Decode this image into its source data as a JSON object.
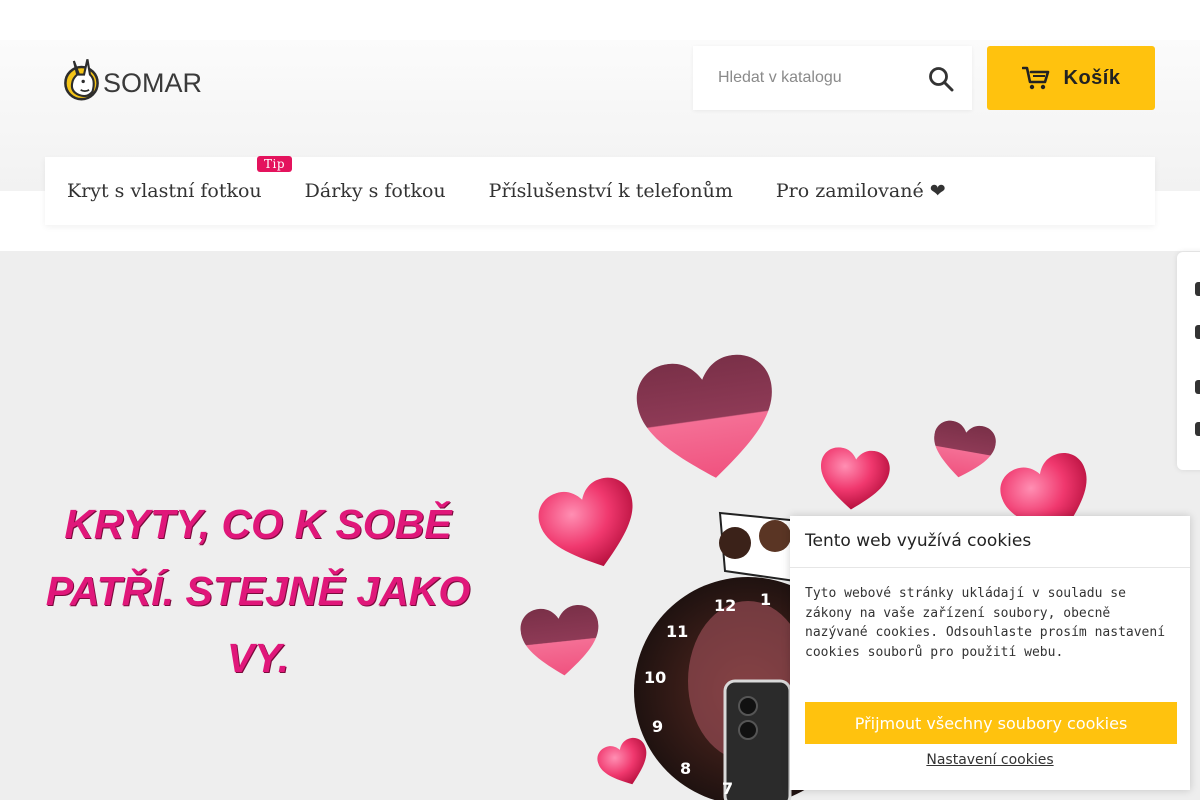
{
  "brand": {
    "logo_text": "SOMAR"
  },
  "search": {
    "placeholder": "Hledat v katalogu"
  },
  "cart": {
    "label": "Košík"
  },
  "nav": {
    "items": [
      {
        "label": "Kryt s vlastní fotkou",
        "badge": "Tip"
      },
      {
        "label": "Dárky s fotkou"
      },
      {
        "label": "Příslušenství k telefonům"
      },
      {
        "label": "Pro zamilované ❤"
      }
    ]
  },
  "hero": {
    "title_line1": "KRYTY, CO K SOBĚ",
    "title_line2": "PATŘÍ. STEJNĚ JAKO",
    "title_line3": "VY.",
    "clock_numbers": [
      "12",
      "1",
      "11",
      "10",
      "9",
      "8",
      "7"
    ]
  },
  "cookie_banner": {
    "title": "Tento web využívá cookies",
    "body": "Tyto webové stránky ukládají v souladu se zákony na vaše zařízení soubory, obecně nazývané cookies. Odsouhlaste prosím nastavení cookies souborů pro použití webu.",
    "accept_label": "Přijmout všechny soubory cookies",
    "settings_label": "Nastavení cookies"
  },
  "colors": {
    "accent_yellow": "#ffc20e",
    "hero_pink": "#e0177a",
    "badge_pink": "#e4135d"
  }
}
